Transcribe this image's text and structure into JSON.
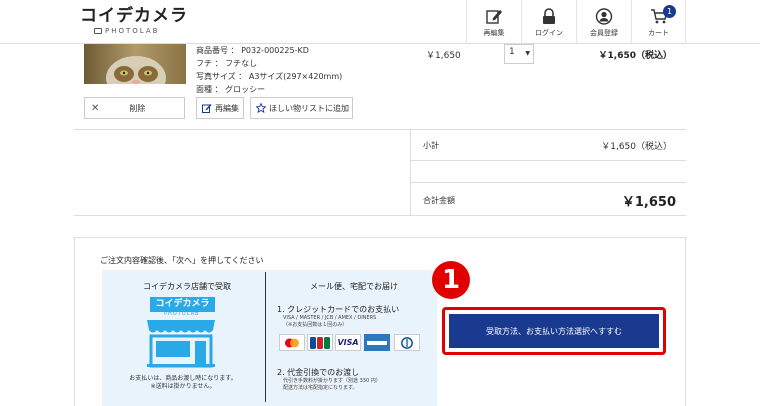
{
  "header": {
    "logo_main": "コイデカメラ",
    "logo_sub": "PHOTOLAB",
    "nav": [
      {
        "label": "再編集",
        "icon": "edit-icon"
      },
      {
        "label": "ログイン",
        "icon": "lock-icon"
      },
      {
        "label": "会員登録",
        "icon": "user-icon"
      },
      {
        "label": "カート",
        "icon": "cart-icon"
      }
    ],
    "cart_count": "1"
  },
  "item": {
    "specs": [
      "商品番号 ： P032-000225-KD",
      "フチ ： フチなし",
      "写真サイズ ： A3サイズ(297×420mm)",
      "面種 ： グロッシー"
    ],
    "unit_price": "￥1,650",
    "quantity": "1",
    "line_total": "￥1,650（税込）",
    "delete_label": "削除",
    "reedit_label": "再編集",
    "wishlist_label": "ほしい物リストに追加"
  },
  "summary": {
    "subtotal_label": "小計",
    "subtotal_value": "￥1,650（税込）",
    "total_label": "合計金額",
    "total_value": "￥1,650"
  },
  "guide": {
    "note": "ご注文内容確認後、「次へ」を押してください",
    "store_title": "コイデカメラ店舗で受取",
    "store_sign": "コイデカメラ",
    "store_sub": "PHOTOLAB",
    "store_note1": "お支払いは、商品お渡し時になります。",
    "store_note2": "※送料は掛かりません。",
    "delivery_title": "メール便、宅配でお届け",
    "pay1_title": "1. クレジットカードでのお支払い",
    "pay1_sub1": "VISA / MASTER / JCB / AMEX / DINERS",
    "pay1_sub2": "（※お支払回数は１回のみ）",
    "cards": [
      "mastercard",
      "JCB",
      "VISA",
      "AMERICAN EXPRESS",
      "Diners Club"
    ],
    "pay2_title": "2. 代金引換でのお渡し",
    "pay2_sub1": "代引き手数料が掛かります（別途 330 円）",
    "pay2_sub2": "配送方法は宅配指定になります。"
  },
  "step_number": "1",
  "cta_label": "受取方法、お支払い方法選択へすすむ",
  "colors": {
    "primary": "#1a3a8f",
    "highlight": "#e00000",
    "store_blue": "#29a9e8",
    "guide_bg": "#e9f3fb"
  }
}
